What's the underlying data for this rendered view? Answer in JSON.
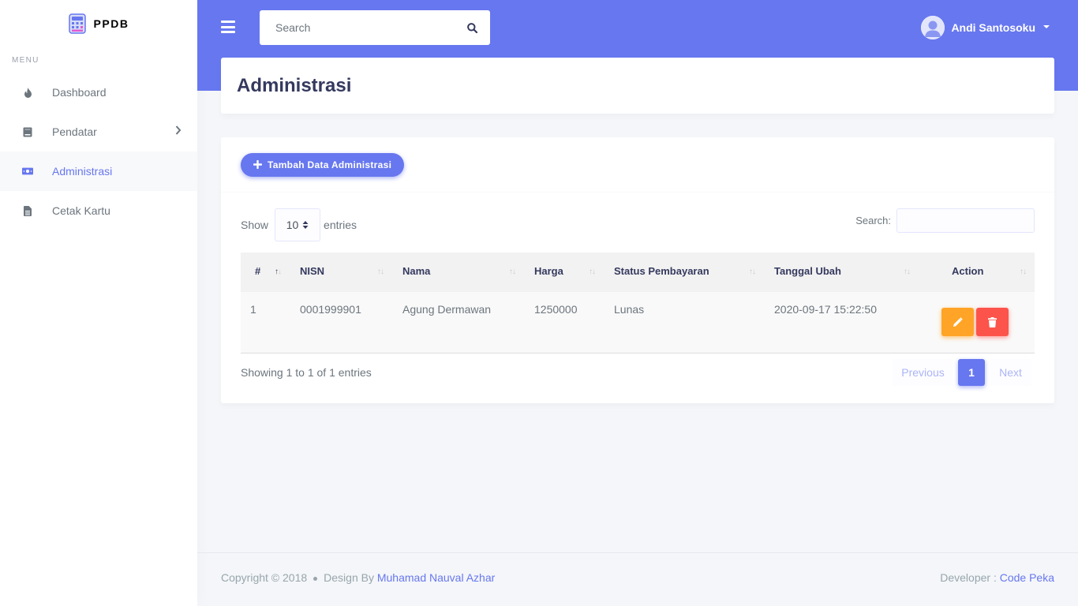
{
  "brand": {
    "name": "PPDB"
  },
  "sidebar": {
    "menu_header": "MENU",
    "items": [
      {
        "label": "Dashboard",
        "icon": "fire-icon"
      },
      {
        "label": "Pendatar",
        "icon": "book-icon",
        "has_submenu": true
      },
      {
        "label": "Administrasi",
        "icon": "money-bill-icon",
        "active": true
      },
      {
        "label": "Cetak Kartu",
        "icon": "file-icon"
      }
    ]
  },
  "topbar": {
    "search_placeholder": "Search",
    "user_name": "Andi Santosoku"
  },
  "page": {
    "title": "Administrasi"
  },
  "card": {
    "add_button_label": "Tambah Data Administrasi",
    "length": {
      "prefix": "Show",
      "value": "10",
      "suffix": "entries"
    },
    "filter_label": "Search:",
    "columns": [
      "#",
      "NISN",
      "Nama",
      "Harga",
      "Status Pembayaran",
      "Tanggal Ubah",
      "Action"
    ],
    "rows": [
      {
        "no": "1",
        "nisn": "0001999901",
        "nama": "Agung Dermawan",
        "harga": "1250000",
        "status": "Lunas",
        "tanggal": "2020-09-17 15:22:50"
      }
    ],
    "info": "Showing 1 to 1 of 1 entries",
    "pagination": {
      "previous": "Previous",
      "current": "1",
      "next": "Next"
    }
  },
  "footer": {
    "copyright": "Copyright © 2018",
    "design_by": "Design By",
    "designer": "Muhamad Nauval Azhar",
    "developer_label": "Developer :",
    "developer": "Code Peka"
  },
  "colors": {
    "primary": "#6777ef",
    "warning": "#ffa426",
    "danger": "#fc544b",
    "background": "#f4f6f9"
  }
}
